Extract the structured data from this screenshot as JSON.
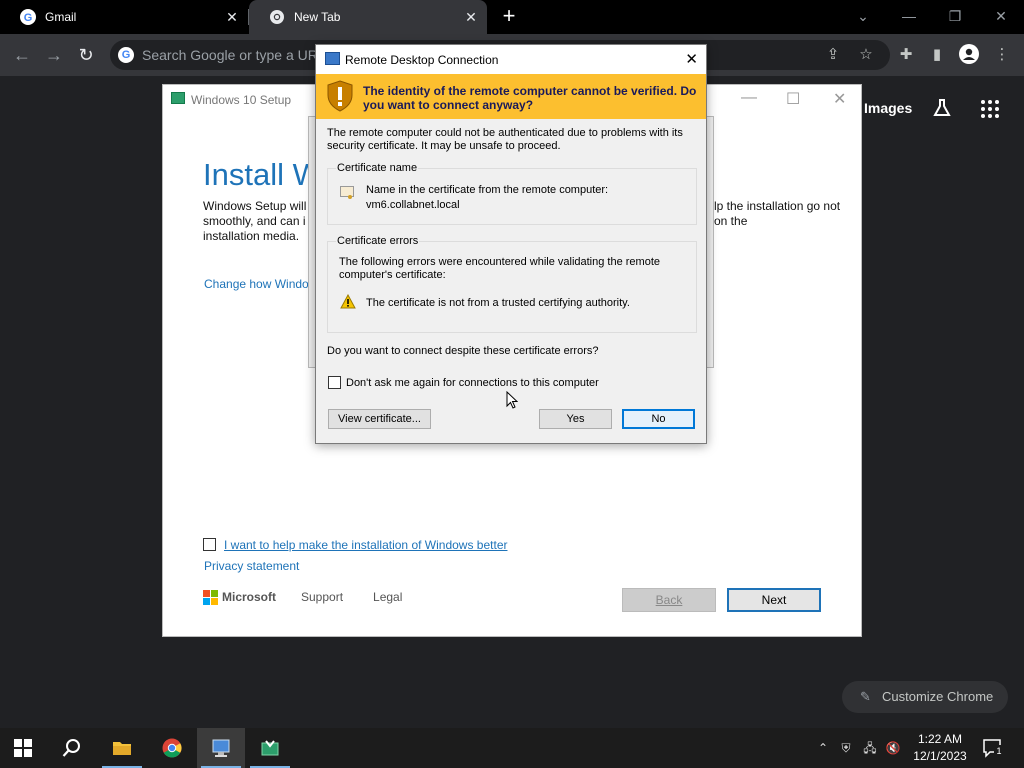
{
  "browser": {
    "tabs": [
      {
        "title": "Gmail"
      },
      {
        "title": "New Tab"
      }
    ],
    "omnibox_placeholder": "Search Google or type a URL",
    "ntp": {
      "images": "Images",
      "customize": "Customize Chrome"
    }
  },
  "setup": {
    "title": "Windows 10 Setup",
    "heading": "Install W",
    "body_left": "Windows Setup will smoothly, and can i installation media.",
    "body_right": "lp the installation go not on the",
    "link": "Change how Windo",
    "help_check": "I want to help make the installation of Windows better",
    "privacy": "Privacy statement",
    "brand": "Microsoft",
    "support": "Support",
    "legal": "Legal",
    "back": "Back",
    "next": "Next"
  },
  "rdp": {
    "title": "Remote Desktop Connection",
    "banner": "The identity of the remote computer cannot be verified. Do you want to connect anyway?",
    "intro": "The remote computer could not be authenticated due to problems with its security certificate. It may be unsafe to proceed.",
    "cert_group_label": "Certificate name",
    "cert_name_label": "Name in the certificate from the remote computer:",
    "cert_name_value": "vm6.collabnet.local",
    "errors_group_label": "Certificate errors",
    "errors_intro": "The following errors were encountered while validating the remote computer's certificate:",
    "error_item": "The certificate is not from a trusted certifying authority.",
    "question": "Do you want to connect despite these certificate errors?",
    "dont_ask": "Don't ask me again for connections to this computer",
    "view_cert": "View certificate...",
    "yes": "Yes",
    "no": "No"
  },
  "taskbar": {
    "time": "1:22 AM",
    "date": "12/1/2023",
    "notifications": "1"
  },
  "colors": {
    "banner": "#fcbf2f",
    "setup_blue": "#1e73b8",
    "chrome_dark": "#35363a"
  }
}
